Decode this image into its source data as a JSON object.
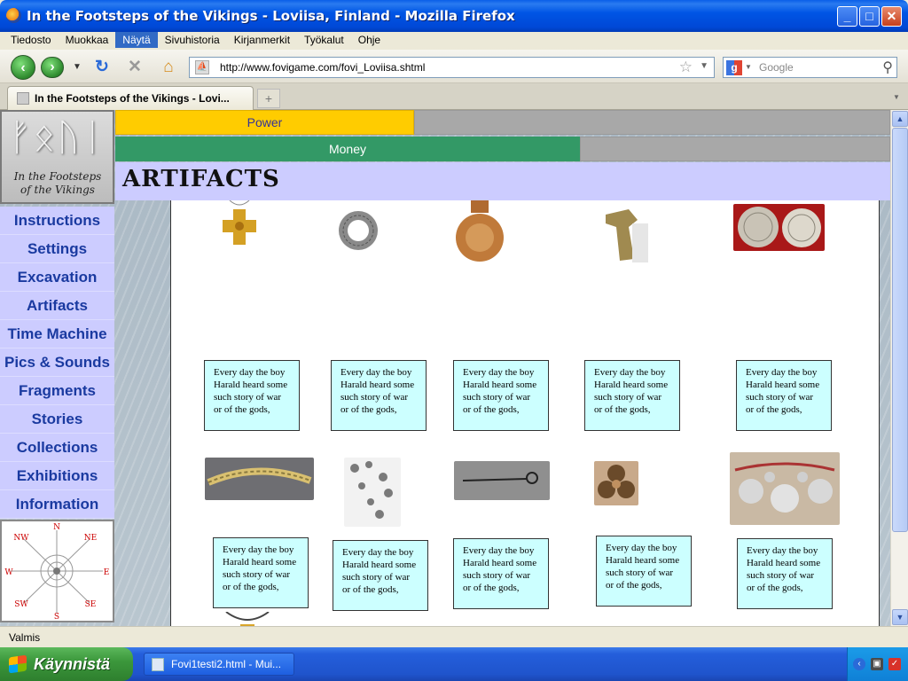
{
  "window": {
    "title": "In the Footsteps of the Vikings - Loviisa, Finland - Mozilla Firefox"
  },
  "menu": {
    "items": [
      "Tiedosto",
      "Muokkaa",
      "Näytä",
      "Sivuhistoria",
      "Kirjanmerkit",
      "Työkalut",
      "Ohje"
    ],
    "active_index": 2
  },
  "navbar": {
    "url": "http://www.fovigame.com/fovi_Loviisa.shtml",
    "search_placeholder": "Google"
  },
  "tab": {
    "label": "In the Footsteps of the Vikings - Lovi..."
  },
  "page": {
    "power_label": "Power",
    "money_label": "Money",
    "heading": "Artifacts",
    "logo_caption_line1": "In the Footsteps",
    "logo_caption_line2": "of the Vikings",
    "nav": [
      "Instructions",
      "Settings",
      "Excavation",
      "Artifacts",
      "Time Machine",
      "Pics & Sounds",
      "Fragments",
      "Stories",
      "Collections",
      "Exhibitions",
      "Information"
    ],
    "compass": {
      "n": "N",
      "ne": "NE",
      "e": "E",
      "se": "SE",
      "s": "S",
      "sw": "SW",
      "w": "W",
      "nw": "NW"
    },
    "story_text": "Every day the boy Harald heard some such story of war or of the gods,",
    "artifacts": [
      {
        "icon": "cross-pendant-icon"
      },
      {
        "icon": "ring-pendant-icon"
      },
      {
        "icon": "brooch-icon"
      },
      {
        "icon": "animal-head-icon"
      },
      {
        "icon": "coins-icon"
      },
      {
        "icon": "bracelet-icon"
      },
      {
        "icon": "beads-icon"
      },
      {
        "icon": "pin-icon"
      },
      {
        "icon": "trefoil-brooch-icon"
      },
      {
        "icon": "silver-pendants-icon"
      },
      {
        "icon": "thor-hammer-icon"
      }
    ]
  },
  "statusbar": {
    "status": "Valmis"
  },
  "taskbar": {
    "start_label": "Käynnistä",
    "task_item": "Fovi1testi2.html - Mui..."
  },
  "colors": {
    "power": "#ffcc00",
    "money": "#339966",
    "nav_bg": "#ccccff",
    "nav_text": "#1a3aa0",
    "story_bg": "#ccffff"
  }
}
